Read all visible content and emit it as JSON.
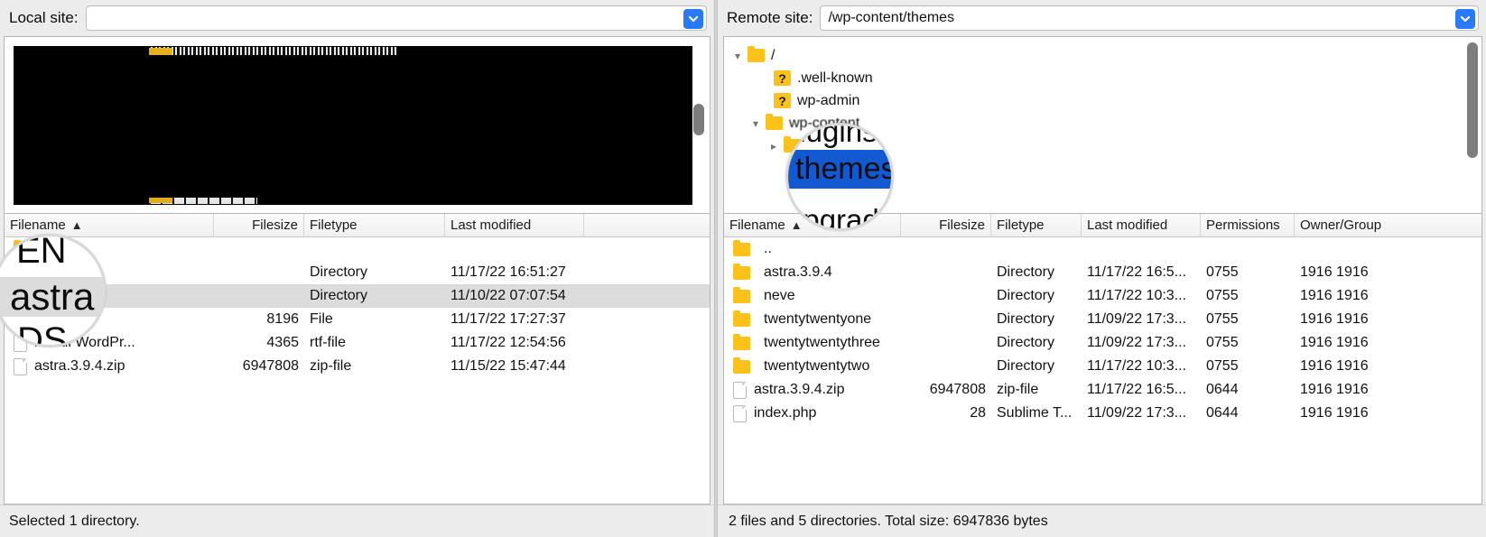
{
  "local": {
    "sitebar": {
      "label": "Local site:",
      "value": "",
      "placeholder": "",
      "dropdown_icon": "chevron-down-icon"
    },
    "tree": {
      "redacted": true
    },
    "columns": [
      "Filename",
      "Filesize",
      "Filetype",
      "Last modified",
      ""
    ],
    "sort_column": "Filename",
    "sort_direction": "ascending",
    "rows": [
      {
        "icon": "folder-icon",
        "name": "",
        "size": "",
        "type": "",
        "modified": "",
        "selected": false
      },
      {
        "icon": "folder-icon",
        "name": "",
        "size": "",
        "type": "Directory",
        "modified": "11/17/22 16:51:27",
        "selected": false
      },
      {
        "icon": "folder-icon",
        "name": "",
        "size": "",
        "type": "Directory",
        "modified": "11/10/22 07:07:54",
        "selected": true
      },
      {
        "icon": "file-icon",
        "name": "",
        "size": "8196",
        "type": "File",
        "modified": "11/17/22 17:27:37",
        "selected": false
      },
      {
        "icon": "file-icon",
        "name": "install WordPr...",
        "size": "4365",
        "type": "rtf-file",
        "modified": "11/17/22 12:54:56",
        "selected": false
      },
      {
        "icon": "file-icon",
        "name": "astra.3.9.4.zip",
        "size": "6947808",
        "type": "zip-file",
        "modified": "11/15/22 15:47:44",
        "selected": false
      }
    ],
    "status": "Selected 1 directory."
  },
  "remote": {
    "sitebar": {
      "label": "Remote site:",
      "value": "/wp-content/themes",
      "dropdown_icon": "chevron-down-icon"
    },
    "tree": [
      {
        "depth": 0,
        "twisty": "expanded",
        "icon": "folder-icon",
        "label": "/"
      },
      {
        "depth": 1,
        "twisty": "none",
        "icon": "question-icon",
        "label": ".well-known"
      },
      {
        "depth": 1,
        "twisty": "none",
        "icon": "question-icon",
        "label": "wp-admin"
      },
      {
        "depth": 1,
        "twisty": "expanded",
        "icon": "folder-icon",
        "label": "wp-content"
      },
      {
        "depth": 2,
        "twisty": "collapsed",
        "icon": "folder-icon",
        "label": "themes"
      }
    ],
    "columns": [
      "Filename",
      "Filesize",
      "Filetype",
      "Last modified",
      "Permissions",
      "Owner/Group"
    ],
    "sort_column": "Filename",
    "sort_direction": "ascending",
    "rows": [
      {
        "icon": "folder-icon",
        "name": "..",
        "size": "",
        "type": "",
        "modified": "",
        "permissions": "",
        "owner": ""
      },
      {
        "icon": "folder-icon",
        "name": "astra.3.9.4",
        "size": "",
        "type": "Directory",
        "modified": "11/17/22 16:5...",
        "permissions": "0755",
        "owner": "1916 1916"
      },
      {
        "icon": "folder-icon",
        "name": "neve",
        "size": "",
        "type": "Directory",
        "modified": "11/17/22 10:3...",
        "permissions": "0755",
        "owner": "1916 1916"
      },
      {
        "icon": "folder-icon",
        "name": "twentytwentyone",
        "size": "",
        "type": "Directory",
        "modified": "11/09/22 17:3...",
        "permissions": "0755",
        "owner": "1916 1916"
      },
      {
        "icon": "folder-icon",
        "name": "twentytwentythree",
        "size": "",
        "type": "Directory",
        "modified": "11/09/22 17:3...",
        "permissions": "0755",
        "owner": "1916 1916"
      },
      {
        "icon": "folder-icon",
        "name": "twentytwentytwo",
        "size": "",
        "type": "Directory",
        "modified": "11/17/22 10:3...",
        "permissions": "0755",
        "owner": "1916 1916"
      },
      {
        "icon": "file-icon",
        "name": "astra.3.9.4.zip",
        "size": "6947808",
        "type": "zip-file",
        "modified": "11/17/22 16:5...",
        "permissions": "0644",
        "owner": "1916 1916"
      },
      {
        "icon": "file-icon",
        "name": "index.php",
        "size": "28",
        "type": "Sublime T...",
        "modified": "11/09/22 17:3...",
        "permissions": "0644",
        "owner": "1916 1916"
      }
    ],
    "status": "2 files and 5 directories. Total size: 6947836 bytes"
  },
  "magnifiers": {
    "left": {
      "lines": [
        "EN",
        "astra",
        "DS"
      ],
      "highlight_row": "astra"
    },
    "right": {
      "above": "plugins",
      "focus": "themes",
      "below": "upgrade",
      "highlight_color": "#1359d1"
    }
  },
  "colors": {
    "accent_blue": "#2979ff",
    "selection_blue": "#1359d1",
    "folder_yellow": "#fcc219",
    "row_selected_gray": "#dcdcdc",
    "chrome_gray": "#ececec"
  }
}
